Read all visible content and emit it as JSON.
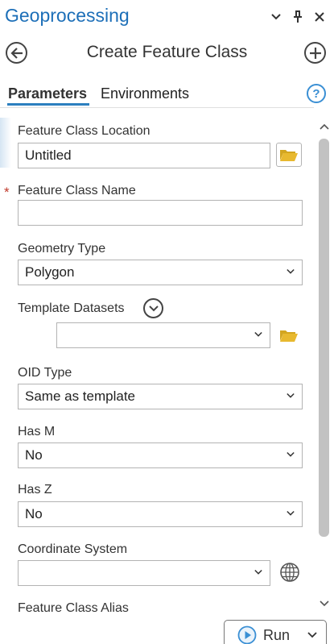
{
  "pane": {
    "title": "Geoprocessing"
  },
  "tool": {
    "title": "Create Feature Class"
  },
  "tabs": [
    {
      "label": "Parameters"
    },
    {
      "label": "Environments"
    }
  ],
  "help": {
    "label": "?"
  },
  "params": {
    "location": {
      "label": "Feature Class Location",
      "value": "Untitled"
    },
    "name": {
      "label": "Feature Class Name",
      "value": "",
      "required_mark": "*"
    },
    "geometry": {
      "label": "Geometry Type",
      "value": "Polygon"
    },
    "template": {
      "label": "Template Datasets",
      "value": ""
    },
    "oid": {
      "label": "OID Type",
      "value": "Same as template"
    },
    "has_m": {
      "label": "Has M",
      "value": "No"
    },
    "has_z": {
      "label": "Has Z",
      "value": "No"
    },
    "coord": {
      "label": "Coordinate System",
      "value": ""
    },
    "alias": {
      "label": "Feature Class Alias"
    }
  },
  "run": {
    "label": "Run"
  },
  "colors": {
    "title_blue": "#1d6fb8",
    "accent_blue": "#2c7fbf",
    "folder_yellow": "#e8b92f",
    "required_red": "#c0392b"
  }
}
